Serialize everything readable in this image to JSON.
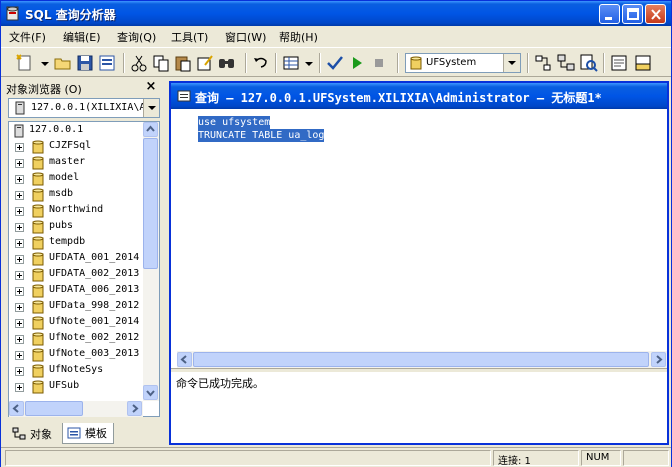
{
  "window": {
    "title": "SQL 查询分析器"
  },
  "menu": [
    {
      "label": "文件(F)"
    },
    {
      "label": "编辑(E)"
    },
    {
      "label": "查询(Q)"
    },
    {
      "label": "工具(T)"
    },
    {
      "label": "窗口(W)"
    },
    {
      "label": "帮助(H)"
    }
  ],
  "toolbar": {
    "database_selected": "UFSystem",
    "icons": [
      "new-query-icon",
      "open-icon",
      "save-icon",
      "insert-template-icon",
      "cut-icon",
      "copy-icon",
      "paste-icon",
      "clear-window-icon",
      "find-icon",
      "undo-icon",
      "results-mode-icon",
      "parse-icon",
      "execute-icon",
      "stop-icon",
      "database-icon",
      "show-plan-icon",
      "object-browser-icon",
      "object-search-icon",
      "properties-icon",
      "results-pane-icon"
    ]
  },
  "object_browser": {
    "header": "对象浏览器 (O)",
    "server_combo": "127.0.0.1(XILIXIA\\A",
    "tree": [
      {
        "label": "127.0.0.1",
        "root": true
      },
      {
        "label": "CJZFSql"
      },
      {
        "label": "master"
      },
      {
        "label": "model"
      },
      {
        "label": "msdb"
      },
      {
        "label": "Northwind"
      },
      {
        "label": "pubs"
      },
      {
        "label": "tempdb"
      },
      {
        "label": "UFDATA_001_2014"
      },
      {
        "label": "UFDATA_002_2013"
      },
      {
        "label": "UFDATA_006_2013"
      },
      {
        "label": "UFData_998_2012"
      },
      {
        "label": "UfNote_001_2014"
      },
      {
        "label": "UfNote_002_2012"
      },
      {
        "label": "UfNote_003_2013"
      },
      {
        "label": "UfNoteSys"
      },
      {
        "label": "UFSub"
      }
    ],
    "tabs": [
      {
        "label": "对象",
        "selected": true
      },
      {
        "label": "模板",
        "selected": false
      }
    ]
  },
  "query_window": {
    "title": "查询 — 127.0.0.1.UFSystem.XILIXIA\\Administrator — 无标题1*",
    "code_lines": [
      "use ufsystem",
      "TRUNCATE TABLE ua_log"
    ],
    "result_message": "命令已成功完成。"
  },
  "statusbar": {
    "connections": "连接: 1",
    "num": "NUM"
  },
  "colors": {
    "titlebar": "#0055e5",
    "selection": "#316ac5",
    "chrome": "#ece9d8"
  }
}
